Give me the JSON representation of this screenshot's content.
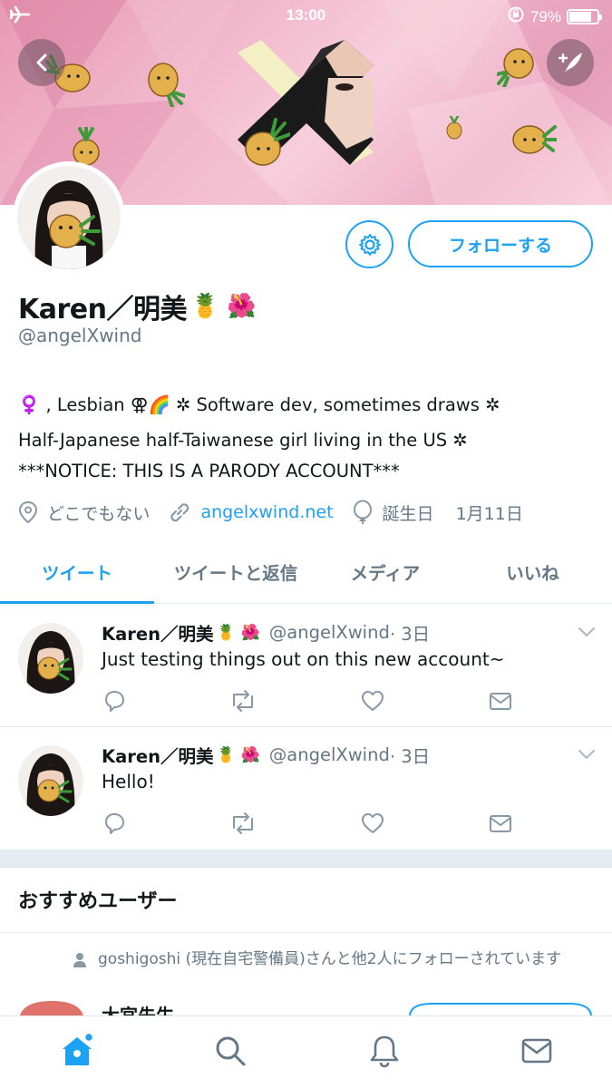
{
  "status_bar": {
    "time": "13:00",
    "battery_percent": "79%",
    "battery_level": 0.79,
    "airplane_icon": "airplane-icon",
    "rotation_lock_icon": "rotation-lock-icon"
  },
  "header": {
    "back_icon": "back-icon",
    "compose_icon": "compose-tweet-icon"
  },
  "profile": {
    "name": "Karen／明美",
    "name_emoji": "🍍 🌺",
    "handle": "@angelXwind",
    "follow_label": "フォローする",
    "bio": [
      "♀️ , Lesbian ⚢🌈 ✲ Software dev, sometimes draws ✲",
      "Half-Japanese half-Taiwanese girl living in the US ✲",
      "***NOTICE: THIS IS A PARODY ACCOUNT***"
    ],
    "location": "どこでもない",
    "website": "angelxwind.net",
    "birthday_label": "誕生日",
    "birthday": "1月11日"
  },
  "tabs": [
    {
      "label": "ツイート",
      "active": true
    },
    {
      "label": "ツイートと返信",
      "active": false
    },
    {
      "label": "メディア",
      "active": false
    },
    {
      "label": "いいね",
      "active": false
    }
  ],
  "tweets": [
    {
      "name": "Karen／明美",
      "name_emoji": "🍍 🌺",
      "handle": "@angelXwind",
      "time": "· 3日",
      "text": "Just testing things out on this new account~"
    },
    {
      "name": "Karen／明美",
      "name_emoji": "🍍 🌺",
      "handle": "@angelXwind",
      "time": "· 3日",
      "text": "Hello!"
    }
  ],
  "recommended": {
    "title": "おすすめユーザー",
    "social_context": "goshigoshi (現在自宅警備員)さんと他2人にフォローされています",
    "user_name": "大宮先生"
  },
  "colors": {
    "accent": "#1da1f2",
    "secondary_text": "#657786",
    "banner_pink": "#f1b6ca"
  },
  "bottom_nav": [
    "home-icon",
    "search-icon",
    "notifications-icon",
    "messages-icon"
  ]
}
